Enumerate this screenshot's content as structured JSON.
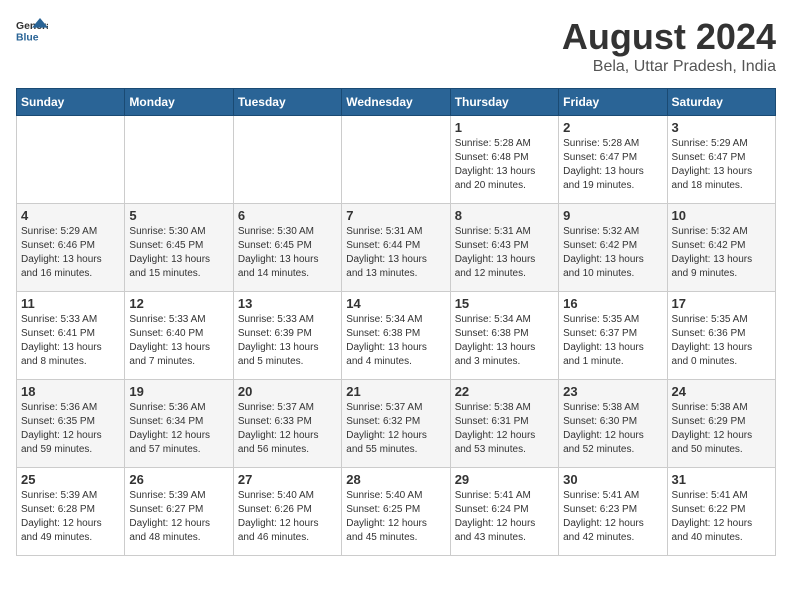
{
  "header": {
    "logo_general": "General",
    "logo_blue": "Blue",
    "month_year": "August 2024",
    "location": "Bela, Uttar Pradesh, India"
  },
  "days_of_week": [
    "Sunday",
    "Monday",
    "Tuesday",
    "Wednesday",
    "Thursday",
    "Friday",
    "Saturday"
  ],
  "weeks": [
    [
      {
        "day": "",
        "info": ""
      },
      {
        "day": "",
        "info": ""
      },
      {
        "day": "",
        "info": ""
      },
      {
        "day": "",
        "info": ""
      },
      {
        "day": "1",
        "info": "Sunrise: 5:28 AM\nSunset: 6:48 PM\nDaylight: 13 hours\nand 20 minutes."
      },
      {
        "day": "2",
        "info": "Sunrise: 5:28 AM\nSunset: 6:47 PM\nDaylight: 13 hours\nand 19 minutes."
      },
      {
        "day": "3",
        "info": "Sunrise: 5:29 AM\nSunset: 6:47 PM\nDaylight: 13 hours\nand 18 minutes."
      }
    ],
    [
      {
        "day": "4",
        "info": "Sunrise: 5:29 AM\nSunset: 6:46 PM\nDaylight: 13 hours\nand 16 minutes."
      },
      {
        "day": "5",
        "info": "Sunrise: 5:30 AM\nSunset: 6:45 PM\nDaylight: 13 hours\nand 15 minutes."
      },
      {
        "day": "6",
        "info": "Sunrise: 5:30 AM\nSunset: 6:45 PM\nDaylight: 13 hours\nand 14 minutes."
      },
      {
        "day": "7",
        "info": "Sunrise: 5:31 AM\nSunset: 6:44 PM\nDaylight: 13 hours\nand 13 minutes."
      },
      {
        "day": "8",
        "info": "Sunrise: 5:31 AM\nSunset: 6:43 PM\nDaylight: 13 hours\nand 12 minutes."
      },
      {
        "day": "9",
        "info": "Sunrise: 5:32 AM\nSunset: 6:42 PM\nDaylight: 13 hours\nand 10 minutes."
      },
      {
        "day": "10",
        "info": "Sunrise: 5:32 AM\nSunset: 6:42 PM\nDaylight: 13 hours\nand 9 minutes."
      }
    ],
    [
      {
        "day": "11",
        "info": "Sunrise: 5:33 AM\nSunset: 6:41 PM\nDaylight: 13 hours\nand 8 minutes."
      },
      {
        "day": "12",
        "info": "Sunrise: 5:33 AM\nSunset: 6:40 PM\nDaylight: 13 hours\nand 7 minutes."
      },
      {
        "day": "13",
        "info": "Sunrise: 5:33 AM\nSunset: 6:39 PM\nDaylight: 13 hours\nand 5 minutes."
      },
      {
        "day": "14",
        "info": "Sunrise: 5:34 AM\nSunset: 6:38 PM\nDaylight: 13 hours\nand 4 minutes."
      },
      {
        "day": "15",
        "info": "Sunrise: 5:34 AM\nSunset: 6:38 PM\nDaylight: 13 hours\nand 3 minutes."
      },
      {
        "day": "16",
        "info": "Sunrise: 5:35 AM\nSunset: 6:37 PM\nDaylight: 13 hours\nand 1 minute."
      },
      {
        "day": "17",
        "info": "Sunrise: 5:35 AM\nSunset: 6:36 PM\nDaylight: 13 hours\nand 0 minutes."
      }
    ],
    [
      {
        "day": "18",
        "info": "Sunrise: 5:36 AM\nSunset: 6:35 PM\nDaylight: 12 hours\nand 59 minutes."
      },
      {
        "day": "19",
        "info": "Sunrise: 5:36 AM\nSunset: 6:34 PM\nDaylight: 12 hours\nand 57 minutes."
      },
      {
        "day": "20",
        "info": "Sunrise: 5:37 AM\nSunset: 6:33 PM\nDaylight: 12 hours\nand 56 minutes."
      },
      {
        "day": "21",
        "info": "Sunrise: 5:37 AM\nSunset: 6:32 PM\nDaylight: 12 hours\nand 55 minutes."
      },
      {
        "day": "22",
        "info": "Sunrise: 5:38 AM\nSunset: 6:31 PM\nDaylight: 12 hours\nand 53 minutes."
      },
      {
        "day": "23",
        "info": "Sunrise: 5:38 AM\nSunset: 6:30 PM\nDaylight: 12 hours\nand 52 minutes."
      },
      {
        "day": "24",
        "info": "Sunrise: 5:38 AM\nSunset: 6:29 PM\nDaylight: 12 hours\nand 50 minutes."
      }
    ],
    [
      {
        "day": "25",
        "info": "Sunrise: 5:39 AM\nSunset: 6:28 PM\nDaylight: 12 hours\nand 49 minutes."
      },
      {
        "day": "26",
        "info": "Sunrise: 5:39 AM\nSunset: 6:27 PM\nDaylight: 12 hours\nand 48 minutes."
      },
      {
        "day": "27",
        "info": "Sunrise: 5:40 AM\nSunset: 6:26 PM\nDaylight: 12 hours\nand 46 minutes."
      },
      {
        "day": "28",
        "info": "Sunrise: 5:40 AM\nSunset: 6:25 PM\nDaylight: 12 hours\nand 45 minutes."
      },
      {
        "day": "29",
        "info": "Sunrise: 5:41 AM\nSunset: 6:24 PM\nDaylight: 12 hours\nand 43 minutes."
      },
      {
        "day": "30",
        "info": "Sunrise: 5:41 AM\nSunset: 6:23 PM\nDaylight: 12 hours\nand 42 minutes."
      },
      {
        "day": "31",
        "info": "Sunrise: 5:41 AM\nSunset: 6:22 PM\nDaylight: 12 hours\nand 40 minutes."
      }
    ]
  ]
}
